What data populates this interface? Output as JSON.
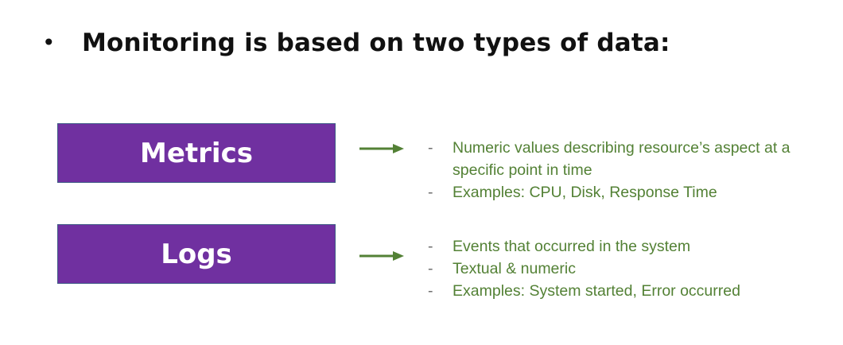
{
  "heading": {
    "bullet": "•",
    "text": "Monitoring is based on two types of data:"
  },
  "metrics": {
    "label": "Metrics",
    "points": [
      "Numeric values describing resource’s aspect at a specific point in time",
      "Examples: CPU, Disk, Response Time"
    ]
  },
  "logs": {
    "label": "Logs",
    "points": [
      "Events that occurred in the system",
      "Textual & numeric",
      "Examples: System started, Error occurred"
    ]
  },
  "colors": {
    "box_fill": "#7030a0",
    "accent_green": "#538135",
    "heading_text": "#111111"
  },
  "icons": [
    "right-arrow-icon",
    "right-arrow-icon"
  ]
}
